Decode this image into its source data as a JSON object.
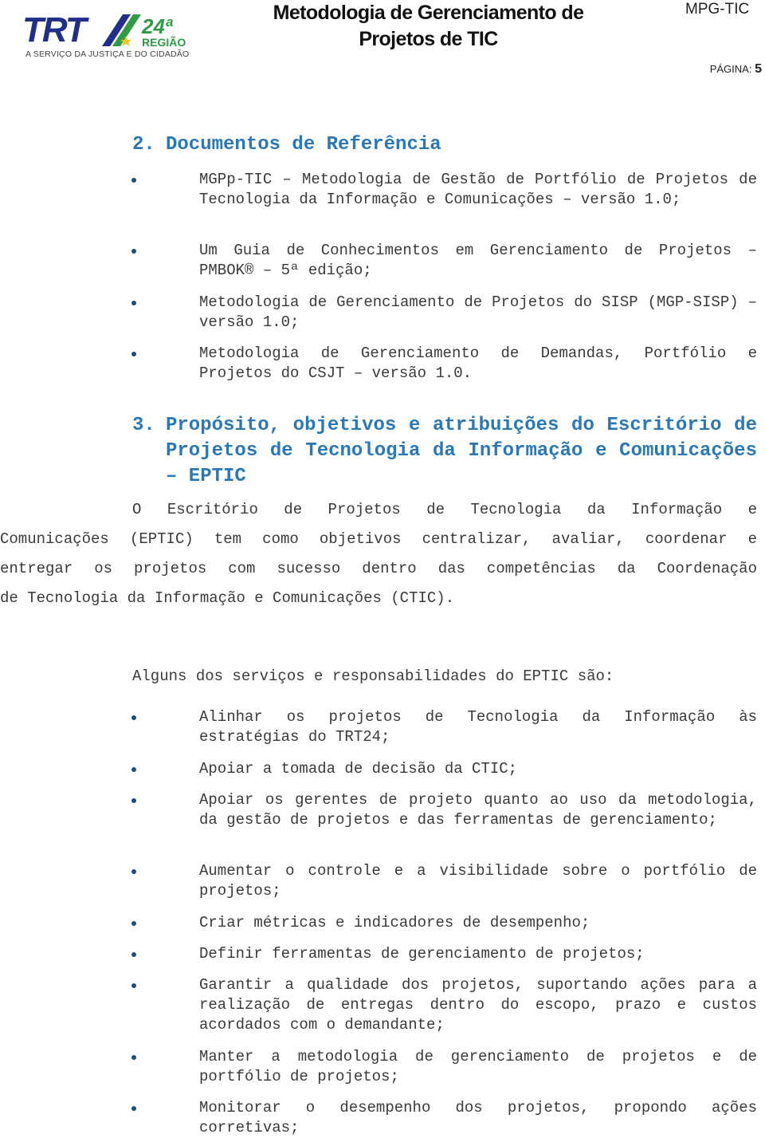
{
  "header": {
    "logo": {
      "primary": "TRT",
      "ordinal": "24ª",
      "region": "REGIÃO",
      "tagline": "A SERVIÇO DA JUSTIÇA E DO CIDADÃO",
      "colors": {
        "blue": "#1f2f8a",
        "green": "#2e9b45",
        "star": "#f2c12e"
      }
    },
    "title_line1": "Metodologia de Gerenciamento de",
    "title_line2": "Projetos de TIC",
    "code": "MPG-TIC",
    "page_label": "PÁGINA:",
    "page_number": "5"
  },
  "section2": {
    "number": "2.",
    "title": "Documentos de Referência",
    "items": [
      "MGPp-TIC – Metodologia de Gestão de Portfólio de Projetos de Tecnologia da Informação e Comunicações – versão 1.0;",
      "Um Guia de Conhecimentos em Gerenciamento de Projetos – PMBOK® – 5ª edição;",
      "Metodologia de Gerenciamento de Projetos do SISP (MGP-SISP) – versão 1.0;",
      "Metodologia de Gerenciamento de Demandas, Portfólio e Projetos do CSJT – versão 1.0."
    ]
  },
  "section3": {
    "number": "3.",
    "title": "Propósito, objetivos e atribuições do Escritório de Projetos de Tecnologia da Informação e Comunicações – EPTIC",
    "paragraph_indent": "O Escritório de Projetos de Tecnologia da Informação e",
    "paragraph_rest": [
      "Comunicações (EPTIC) tem como objetivos centralizar, avaliar, coordenar e",
      "entregar os projetos com sucesso dentro das competências da Coordenação",
      "de Tecnologia da Informação e Comunicações (CTIC)."
    ],
    "intro": "Alguns dos serviços e responsabilidades do EPTIC são:",
    "items": [
      "Alinhar os projetos de Tecnologia da Informação às estratégias do TRT24;",
      "Apoiar a tomada de decisão da CTIC;",
      "Apoiar os gerentes de projeto quanto ao uso da metodologia, da gestão de projetos e das ferramentas de gerenciamento;",
      "Aumentar o controle e a visibilidade sobre o portfólio de projetos;",
      "Criar métricas e indicadores de desempenho;",
      "Definir ferramentas de gerenciamento de projetos;",
      "Garantir a qualidade dos projetos, suportando ações para a realização de entregas dentro do escopo, prazo e custos acordados com o demandante;",
      "Manter a metodologia de gerenciamento de projetos e de portfólio de projetos;",
      "Monitorar o desempenho dos projetos, propondo ações corretivas;"
    ]
  },
  "colors": {
    "heading": "#2a78b4",
    "bullet": "#1e4f7a",
    "text": "#3a3a3a"
  }
}
